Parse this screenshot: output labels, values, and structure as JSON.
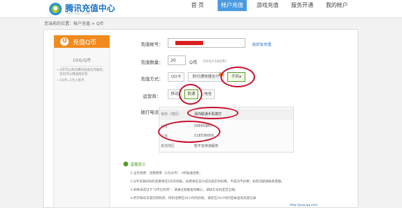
{
  "header": {
    "logo_title": "腾讯充值中心",
    "logo_subtitle": "PAY.QQ.COM",
    "nav": [
      "首 页",
      "帐户充值",
      "游戏充值",
      "服务开通",
      "我的帐户"
    ],
    "active_index": 1
  },
  "breadcrumb": "您当前的位置：帐户充值 > Q币",
  "sidebar": {
    "title": "充值Q币",
    "coin_glyph": "Q",
    "price": "10元/Q币",
    "notes": [
      "Q币可以购买腾讯各类包月服务，您也可以赠送给好友",
      "1Q币=1元人民币"
    ]
  },
  "form": {
    "account_label": "充值帐号：",
    "account_value": "",
    "account_link": "给好友充值",
    "amount_label": "充值数量：",
    "amount_value": "20",
    "amount_unit": "Q币",
    "amount_hint": "（10元=10Q币）",
    "method_label": "充值方式：",
    "methods": [
      "QQ卡",
      "财付通快捷支付",
      "手机"
    ],
    "method_selected": 2,
    "operator_label": "运营商：",
    "operators": [
      "移动",
      "联通",
      "电信"
    ],
    "operator_selected": 1,
    "phone_label": "拨打电话：",
    "phone_rows": [
      {
        "label": "省份（地区）",
        "value": "请向联通手机拨打"
      },
      {
        "label": "北京",
        "value": "16665983"
      },
      {
        "label": "江苏",
        "value": "118336000"
      },
      {
        "label": "其他地区",
        "value": "暂不支持该服务"
      }
    ]
  },
  "tips": {
    "title": "温馨提示",
    "lines": [
      "1.业务资费：话费费用（1元/Q币）+所拨通话费；",
      "2.Q币充值扣除的话费将在5日内到账，扣费将在支付成功后实时扣费，不成功不扣费；如有问题请联系客服。",
      "3.如果未成功卡“Q币已扣完”，请通过套餐查询确认，请核实号码是否正确；",
      "4.所示每日充值仅限购买，所扣话费在24小时内扣款，请您在24小时内登录查询充值记录"
    ],
    "link": "http://pay.qq.com"
  },
  "colors": {
    "brand": "#1a72c0",
    "active_nav": "#4a9be0",
    "orange": "#f08a1c",
    "annotation": "#c8102e",
    "green": "#5a9a2a"
  }
}
